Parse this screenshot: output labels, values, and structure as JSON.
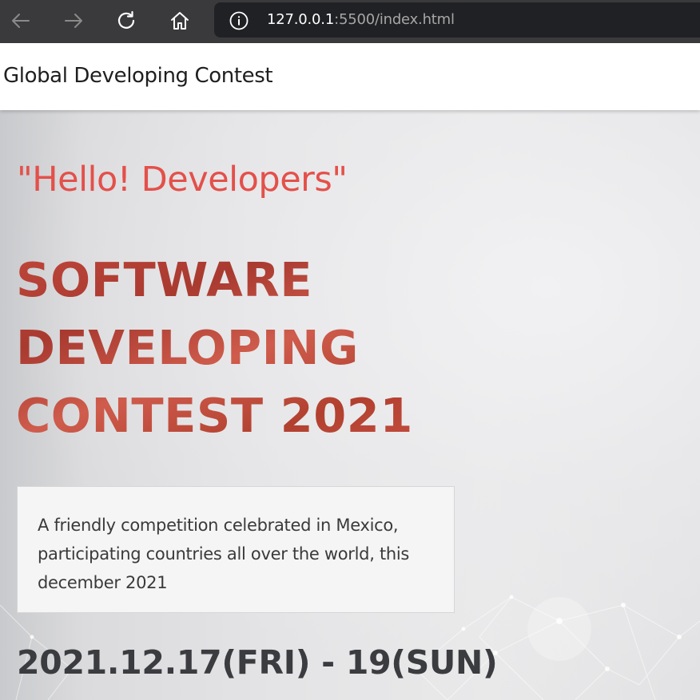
{
  "browser": {
    "url_host": "127.0.0.1",
    "url_rest": ":5500/index.html",
    "icons": {
      "back": "arrow-left-icon",
      "forward": "arrow-right-icon",
      "reload": "reload-icon",
      "home": "home-icon",
      "info": "info-icon"
    }
  },
  "site": {
    "title": "Global Developing Contest"
  },
  "hero": {
    "greeting": "\"Hello! Developers\"",
    "headline_lines": [
      "SOFTWARE",
      "DEVELOPING",
      "CONTEST 2021"
    ],
    "description": "A friendly competition celebrated in Mexico, participating countries all over the world, this december 2021",
    "date": "2021.12.17(FRI) - 19(SUN)"
  },
  "colors": {
    "greeting": "#e4504a",
    "headline": "#b94136",
    "date": "#3b3c40",
    "chrome": "#3a3a3c",
    "address_bar": "#202124"
  }
}
